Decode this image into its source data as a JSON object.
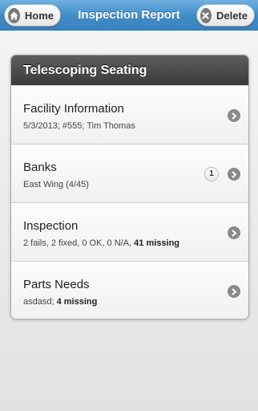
{
  "header": {
    "home_label": "Home",
    "title": "Inspection Report",
    "delete_label": "Delete",
    "home_icon": "home-icon",
    "delete_icon": "close-icon"
  },
  "section": {
    "title": "Telescoping Seating",
    "items": [
      {
        "title": "Facility Information",
        "subtitle": "5/3/2013; #555; Tim Thomas",
        "subtitle_bold": ""
      },
      {
        "title": "Banks",
        "subtitle": "East Wing (4/45)",
        "subtitle_bold": "",
        "badge": "1"
      },
      {
        "title": "Inspection",
        "subtitle": "2 fails, 2 fixed, 0 OK, 0 N/A, ",
        "subtitle_bold": "41 missing"
      },
      {
        "title": "Parts Needs",
        "subtitle": "asdasd; ",
        "subtitle_bold": "4 missing"
      }
    ]
  },
  "colors": {
    "header_blue": "#3f8bc8",
    "card_header": "#4a4a4a",
    "chevron": "#8a8a8a"
  }
}
